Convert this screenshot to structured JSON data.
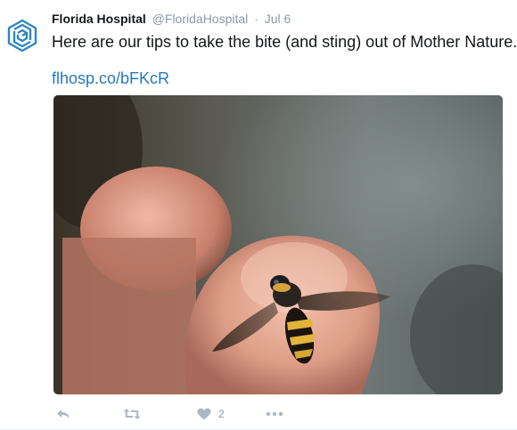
{
  "tweet": {
    "author_name": "Florida Hospital",
    "handle": "@FloridaHospital",
    "separator": "·",
    "date": "Jul 6",
    "text": "Here are our tips to take the bite (and sting) out of Mother Nature.",
    "link": "flhosp.co/bFKcR",
    "avatar_icon": "florida-hospital-logo",
    "media_subject": "hoverfly-on-fingertip-photo"
  },
  "actions": {
    "reply_icon": "reply-icon",
    "retweet_icon": "retweet-icon",
    "like_icon": "heart-icon",
    "like_count": "2",
    "more_icon": "ellipsis-icon"
  },
  "colors": {
    "link": "#2a7ab8",
    "muted": "#8899a6",
    "icon": "#aab8c2",
    "logo": "#2f85c2"
  }
}
